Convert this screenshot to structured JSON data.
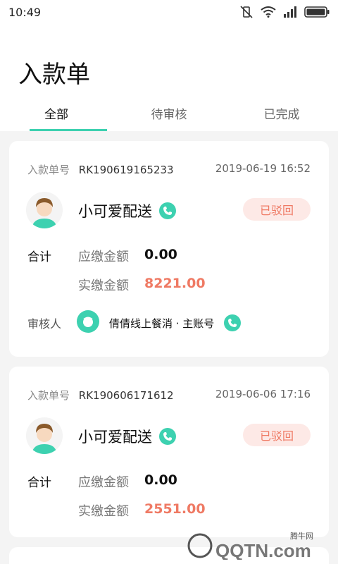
{
  "status_bar": {
    "time": "10:49"
  },
  "header": {
    "title": "入款单"
  },
  "tabs": [
    {
      "label": "全部",
      "active": true
    },
    {
      "label": "待审核",
      "active": false
    },
    {
      "label": "已完成",
      "active": false
    }
  ],
  "orders": [
    {
      "order_no_label": "入款单号",
      "order_no": "RK190619165233",
      "date": "2019-06-19 16:52",
      "courier": "小可爱配送",
      "status": "已驳回",
      "total_label": "合计",
      "due_label": "应缴金额",
      "due_amount": "0.00",
      "paid_label": "实缴金额",
      "paid_amount": "8221.00",
      "auditor_label": "审核人",
      "auditor_name": "倩倩线上餐消 · 主账号"
    },
    {
      "order_no_label": "入款单号",
      "order_no": "RK190606171612",
      "date": "2019-06-06 17:16",
      "courier": "小可爱配送",
      "status": "已驳回",
      "total_label": "合计",
      "due_label": "应缴金额",
      "due_amount": "0.00",
      "paid_label": "实缴金额",
      "paid_amount": "2551.00"
    }
  ],
  "watermark": {
    "text1": "腾牛网",
    "text2": "QQTN.com"
  },
  "colors": {
    "accent": "#3dd1b0",
    "amount": "#ef7a64",
    "badge_bg": "#fde9e6"
  }
}
